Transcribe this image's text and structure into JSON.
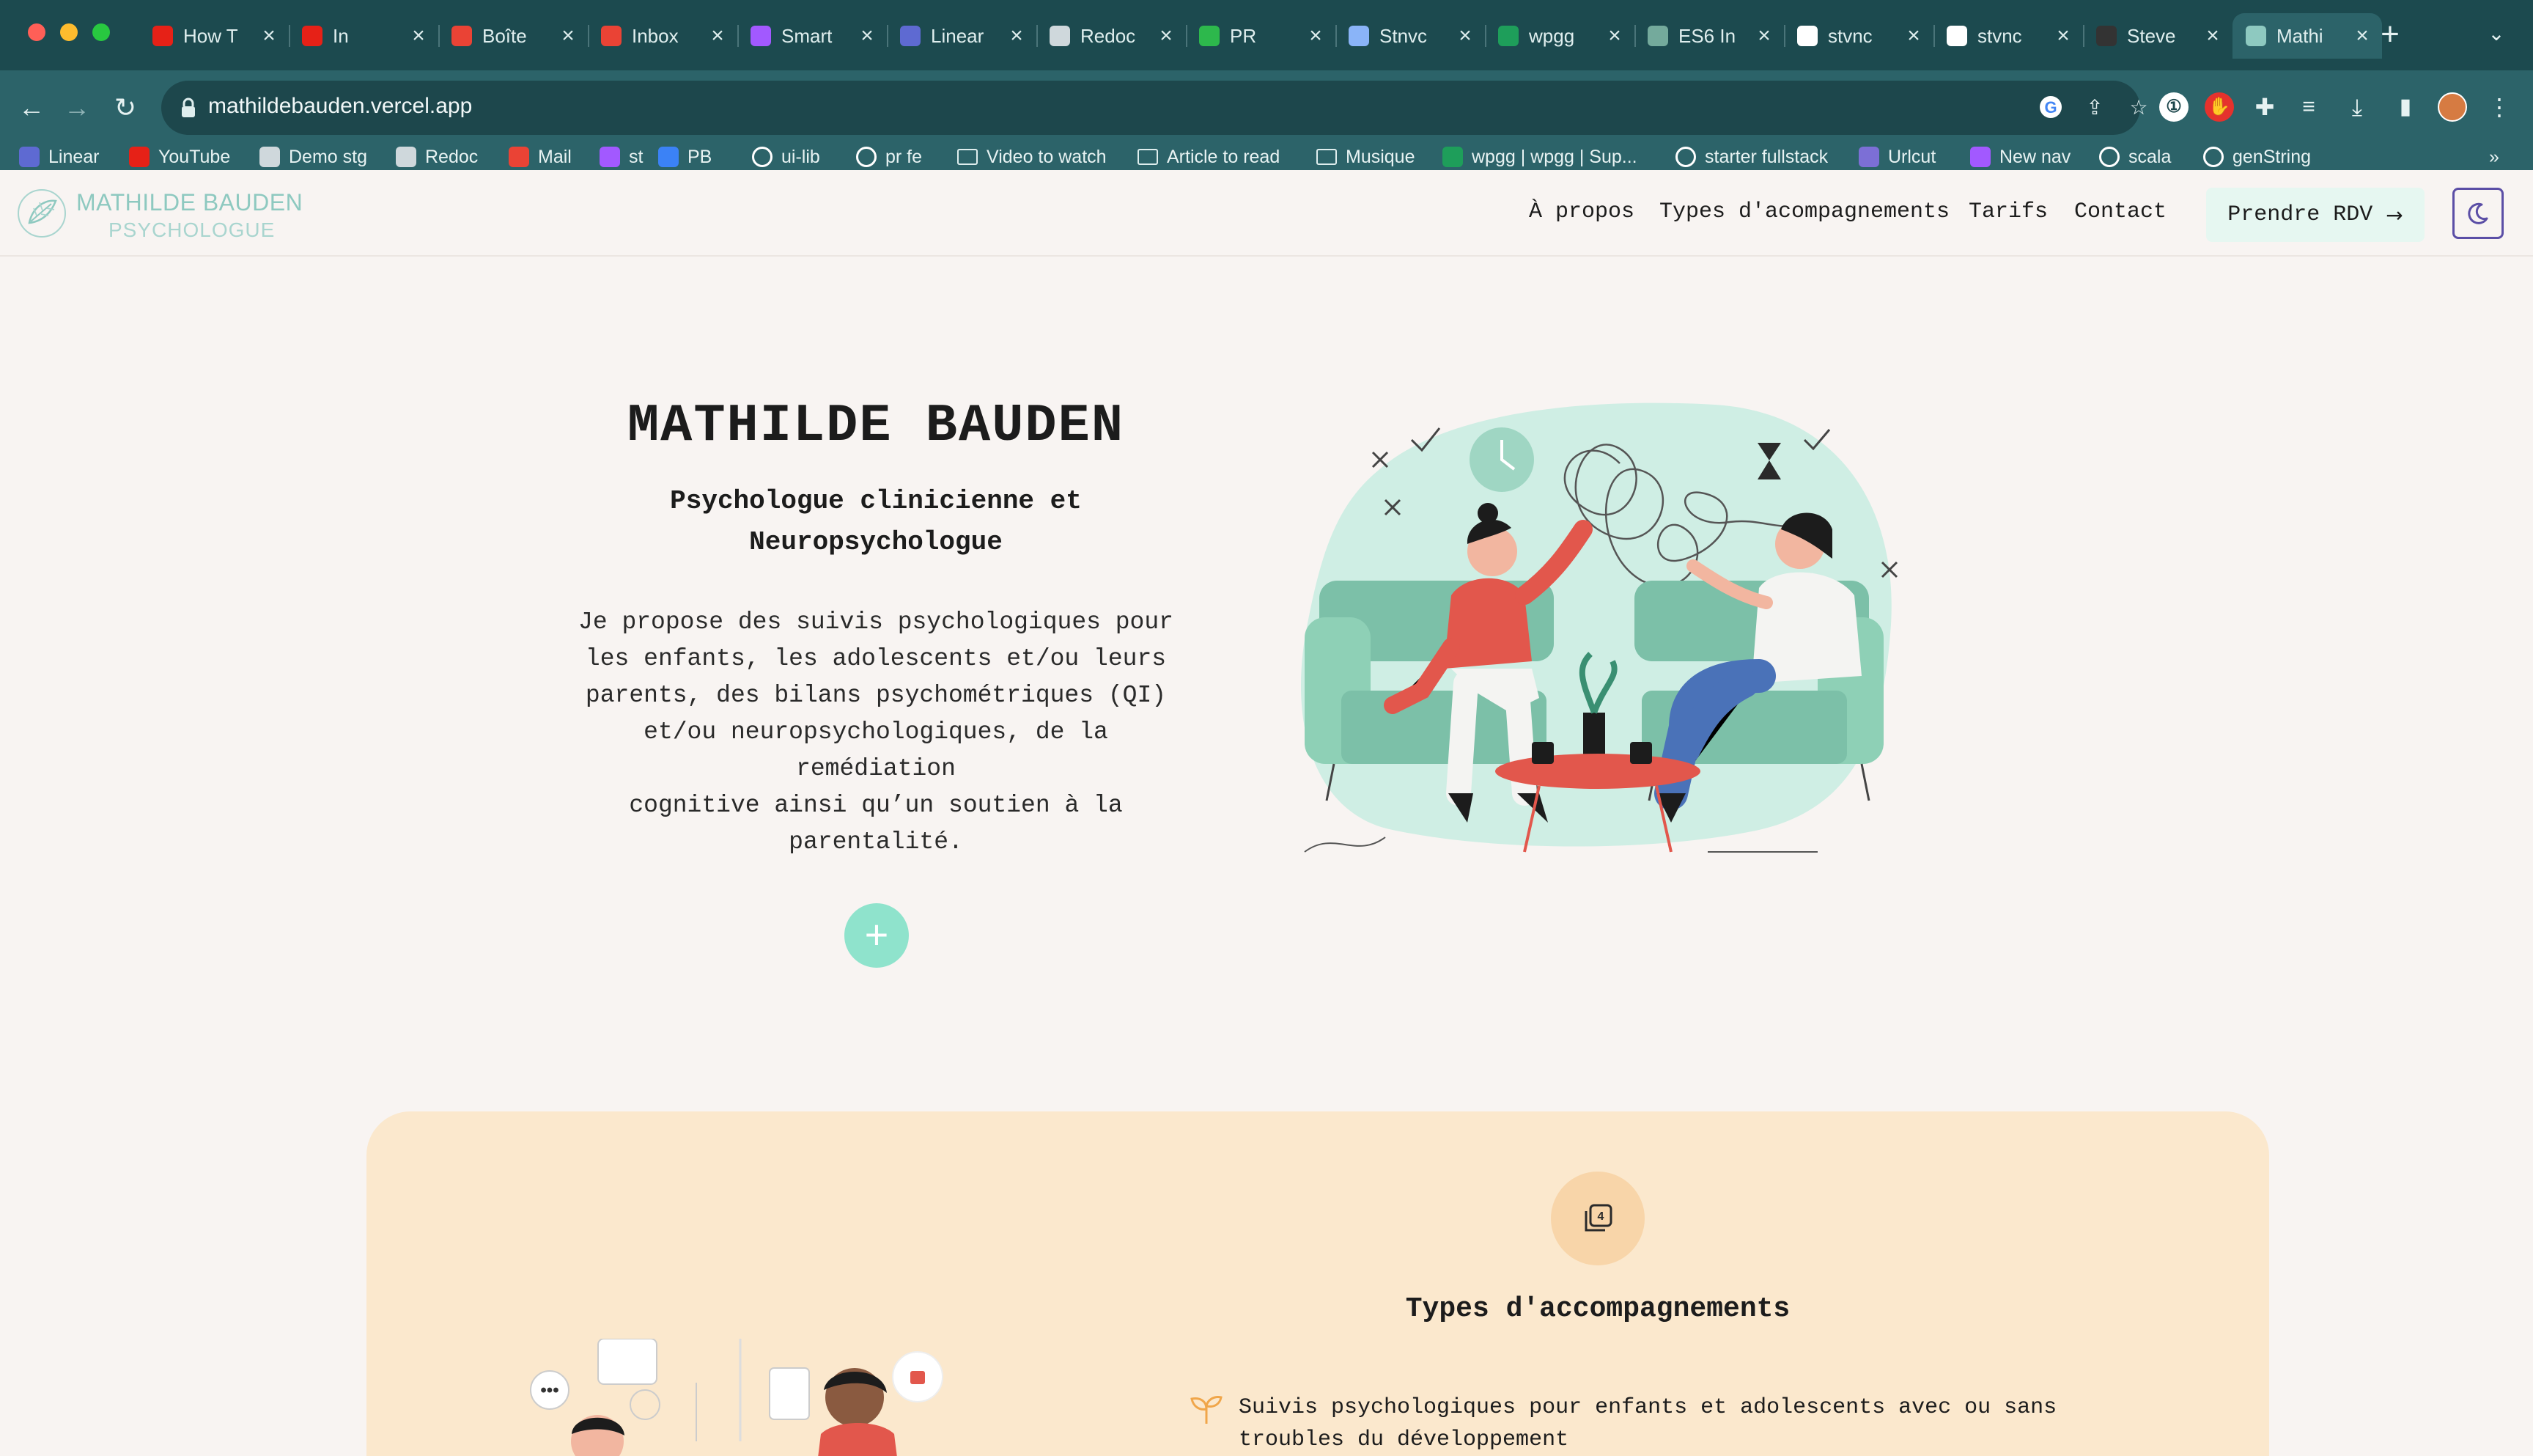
{
  "browser": {
    "tabs": [
      {
        "title": "How T",
        "favicon": "youtube-icon",
        "color": "#e62117"
      },
      {
        "title": "In",
        "favicon": "youtube-icon",
        "color": "#e62117"
      },
      {
        "title": "Boîte",
        "favicon": "gmail-icon",
        "color": "#ea4335"
      },
      {
        "title": "Inbox",
        "favicon": "gmail-icon",
        "color": "#ea4335"
      },
      {
        "title": "Smart",
        "favicon": "figma-icon",
        "color": "#a259ff"
      },
      {
        "title": "Linear",
        "favicon": "linear-icon",
        "color": "#5e6ad2"
      },
      {
        "title": "Redoc",
        "favicon": "redoc-icon",
        "color": "#cfd8dc"
      },
      {
        "title": "PR",
        "favicon": "check-icon",
        "color": "#2db84c"
      },
      {
        "title": "Stnvc",
        "favicon": "doc-icon",
        "color": "#8ab4f8"
      },
      {
        "title": "wpgg",
        "favicon": "wpgg-icon",
        "color": "#1e9e5a"
      },
      {
        "title": "ES6 In",
        "favicon": "openai-icon",
        "color": "#74aa9c"
      },
      {
        "title": "stvnc",
        "favicon": "github-icon",
        "color": "#ffffff"
      },
      {
        "title": "stvnc",
        "favicon": "github-icon",
        "color": "#ffffff"
      },
      {
        "title": "Steve",
        "favicon": "avatar-icon",
        "color": "#333333"
      },
      {
        "title": "Mathi",
        "favicon": "site-logo-icon",
        "color": "#8ec9c0"
      }
    ],
    "url": "mathildebauden.vercel.app",
    "bookmarks": [
      {
        "label": "Linear",
        "icon": "linear-icon",
        "color": "#5e6ad2"
      },
      {
        "label": "YouTube",
        "icon": "youtube-icon",
        "color": "#e62117"
      },
      {
        "label": "Demo stg",
        "icon": "redoc-icon",
        "color": "#cfd8dc"
      },
      {
        "label": "Redoc",
        "icon": "redoc-icon",
        "color": "#cfd8dc"
      },
      {
        "label": "Mail",
        "icon": "gmail-icon",
        "color": "#ea4335"
      },
      {
        "label": "st",
        "icon": "figma-icon",
        "color": "#a259ff"
      },
      {
        "label": "PB",
        "icon": "pb-icon",
        "color": "#3b82f6"
      },
      {
        "label": "ui-lib",
        "icon": "github-icon",
        "color": "#ffffff"
      },
      {
        "label": "pr fe",
        "icon": "github-icon",
        "color": "#ffffff"
      },
      {
        "label": "Video to watch",
        "icon": "folder-icon",
        "color": "#dfeeee"
      },
      {
        "label": "Article to read",
        "icon": "folder-icon",
        "color": "#dfeeee"
      },
      {
        "label": "Musique",
        "icon": "folder-icon",
        "color": "#dfeeee"
      },
      {
        "label": "wpgg | wpgg | Sup...",
        "icon": "wpgg-icon",
        "color": "#1e9e5a"
      },
      {
        "label": "starter fullstack",
        "icon": "github-icon",
        "color": "#ffffff"
      },
      {
        "label": "Urlcut",
        "icon": "link-icon",
        "color": "#7c6fd6"
      },
      {
        "label": "New nav",
        "icon": "figma-icon",
        "color": "#a259ff"
      },
      {
        "label": "scala",
        "icon": "github-icon",
        "color": "#ffffff"
      },
      {
        "label": "genString",
        "icon": "github-icon",
        "color": "#ffffff"
      }
    ],
    "overflow": "»"
  },
  "site": {
    "logo": {
      "name": "MATHILDE BAUDEN",
      "sub": "PSYCHOLOGUE"
    },
    "nav": [
      "À propos",
      "Types d'acompagnements",
      "Tarifs",
      "Contact"
    ],
    "cta": "Prendre RDV",
    "cta_arrow": "→"
  },
  "hero": {
    "title": "MATHILDE BAUDEN",
    "subtitle_line1": "Psychologue clinicienne et",
    "subtitle_line2": "Neuropsychologue",
    "body": [
      "Je propose des suivis psychologiques pour",
      "les enfants, les adolescents et/ou leurs",
      "parents, des bilans psychométriques (QI)",
      "et/ou neuropsychologiques, de la remédiation",
      "cognitive ainsi qu’un soutien à la",
      "parentalité."
    ],
    "plus": "+"
  },
  "types": {
    "title": "Types d'accompagnements",
    "item_line1": "Suivis psychologiques pour enfants et adolescents avec ou sans",
    "item_line2": "troubles du développement"
  },
  "colors": {
    "accent": "#8fe3cc",
    "brand": "#8ec9c0",
    "card": "#fbe8cd",
    "badge": "#f8d5a9",
    "illus_green": "#7cc0a8",
    "illus_red": "#e2574c"
  }
}
